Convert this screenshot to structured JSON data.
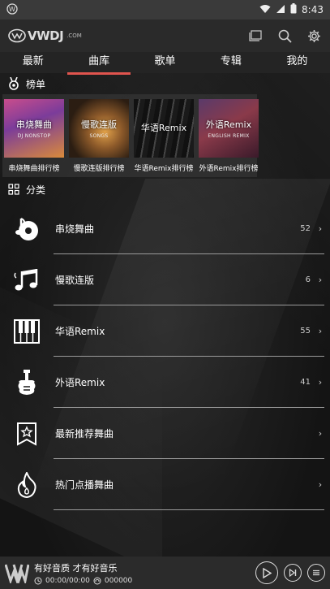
{
  "status_bar": {
    "time": "8:43"
  },
  "app": {
    "logo_text": "VWDJ",
    "logo_sub": ".COM"
  },
  "tabs": [
    {
      "label": "最新"
    },
    {
      "label": "曲库"
    },
    {
      "label": "歌单"
    },
    {
      "label": "专辑"
    },
    {
      "label": "我的"
    }
  ],
  "active_tab": "曲库",
  "rankings": {
    "title": "榜单",
    "items": [
      {
        "label": "串烧舞曲排行榜",
        "cover_title": "串烧舞曲",
        "cover_sub": "DJ NONSTOP"
      },
      {
        "label": "慢歌连版排行榜",
        "cover_title": "慢歌连版",
        "cover_sub": "SONGS"
      },
      {
        "label": "华语Remix排行榜",
        "cover_title": "华语Remix",
        "cover_sub": ""
      },
      {
        "label": "外语Remix排行榜",
        "cover_title": "外语Remix",
        "cover_sub": "ENGLISH REMIX"
      }
    ]
  },
  "categories": {
    "title": "分类",
    "items": [
      {
        "label": "串烧舞曲",
        "count": "52",
        "icon": "music-disc-icon"
      },
      {
        "label": "慢歌连版",
        "count": "6",
        "icon": "music-notes-icon"
      },
      {
        "label": "华语Remix",
        "count": "55",
        "icon": "piano-keys-icon"
      },
      {
        "label": "外语Remix",
        "count": "41",
        "icon": "guitar-icon"
      },
      {
        "label": "最新推荐舞曲",
        "count": "",
        "icon": "star-bookmark-icon"
      },
      {
        "label": "热门点播舞曲",
        "count": "",
        "icon": "flame-icon"
      }
    ]
  },
  "player": {
    "title": "有好音质 才有好音乐",
    "time": "00:00/00:00",
    "plays": "000000"
  }
}
